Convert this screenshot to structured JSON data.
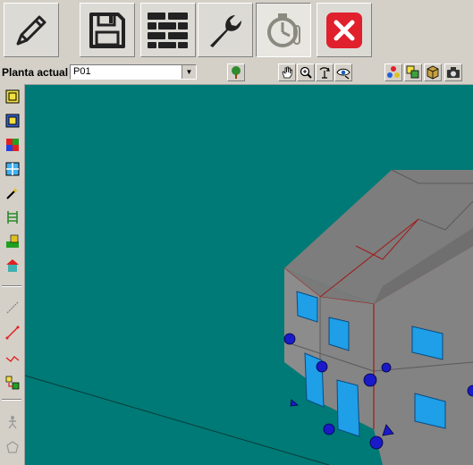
{
  "main_toolbar": {
    "buttons": [
      {
        "name": "edit-pencil-icon"
      },
      {
        "name": "save-floppy-icon"
      },
      {
        "name": "walls-brick-icon"
      },
      {
        "name": "settings-wrench-icon"
      },
      {
        "name": "timer-thermometer-icon"
      },
      {
        "name": "close-red-x-icon"
      }
    ]
  },
  "floor_bar": {
    "label": "Planta actual",
    "current_floor": "P01",
    "tool_icons": [
      "tree-icon",
      "hand-pan-icon",
      "zoom-icon",
      "rotate-icon",
      "eye-view-icon",
      "color-points-icon",
      "layers-icon",
      "3d-box-icon",
      "camera-icon"
    ]
  },
  "left_toolbar": {
    "tool_icons": [
      "wall-square-icon",
      "room-square-icon",
      "colored-blocks-icon",
      "window-grid-icon",
      "magic-wand-icon",
      "ladder-icon",
      "terrain-icon",
      "house-icon",
      "line-icon",
      "red-line-icon",
      "polyline-icon",
      "objects-icon",
      "person-icon",
      "polygon-icon"
    ]
  },
  "colors": {
    "viewport_background": "#007a76",
    "building_face": "#808080",
    "window_blue": "#1e9fe8",
    "node_blue": "#1a1ac8",
    "close_red": "#e0202c"
  }
}
